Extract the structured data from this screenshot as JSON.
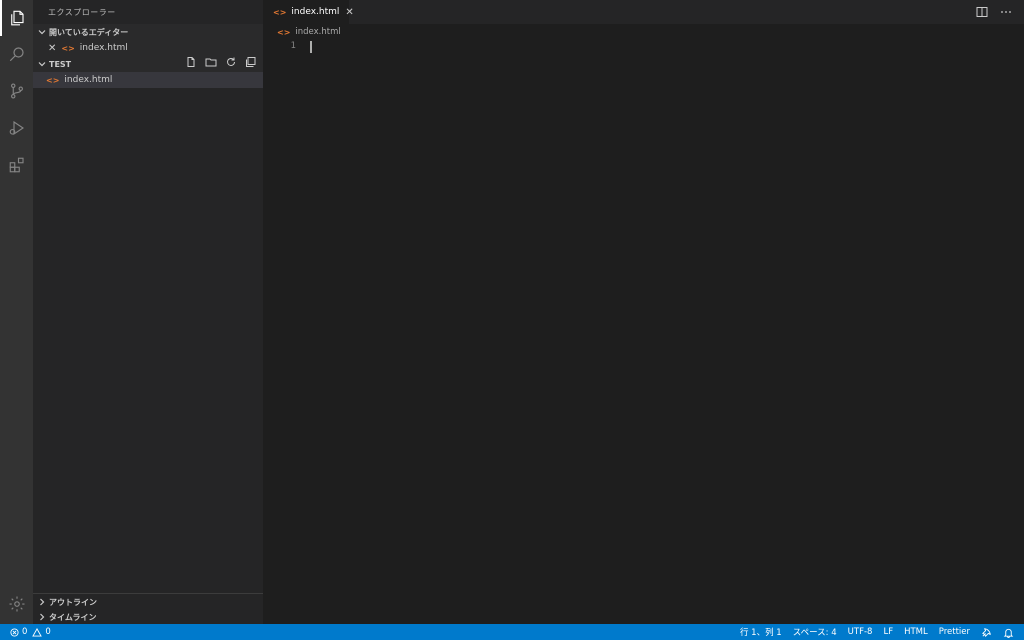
{
  "activity_bar": {
    "items": [
      "files-icon",
      "search-icon",
      "source-control-icon",
      "run-debug-icon",
      "extensions-icon"
    ],
    "bottom": "gear-icon"
  },
  "sidebar": {
    "title": "エクスプローラー",
    "open_editors": {
      "label": "開いているエディター",
      "files": [
        "index.html"
      ]
    },
    "folder": {
      "label": "TEST",
      "files": [
        "index.html"
      ]
    },
    "outline_label": "アウトライン",
    "timeline_label": "タイムライン"
  },
  "editor": {
    "tab_label": "index.html",
    "breadcrumb": "index.html",
    "line_number": "1",
    "file_icon_glyph": "<>"
  },
  "status_bar": {
    "errors": "0",
    "warnings": "0",
    "position": "行 1、列 1",
    "spaces": "スペース: 4",
    "encoding": "UTF-8",
    "eol": "LF",
    "language": "HTML",
    "formatter": "Prettier"
  },
  "colors": {
    "accent": "#007acc",
    "html_icon": "#e37933",
    "activity_bg": "#333333",
    "sidebar_bg": "#252526",
    "editor_bg": "#1e1e1e"
  }
}
